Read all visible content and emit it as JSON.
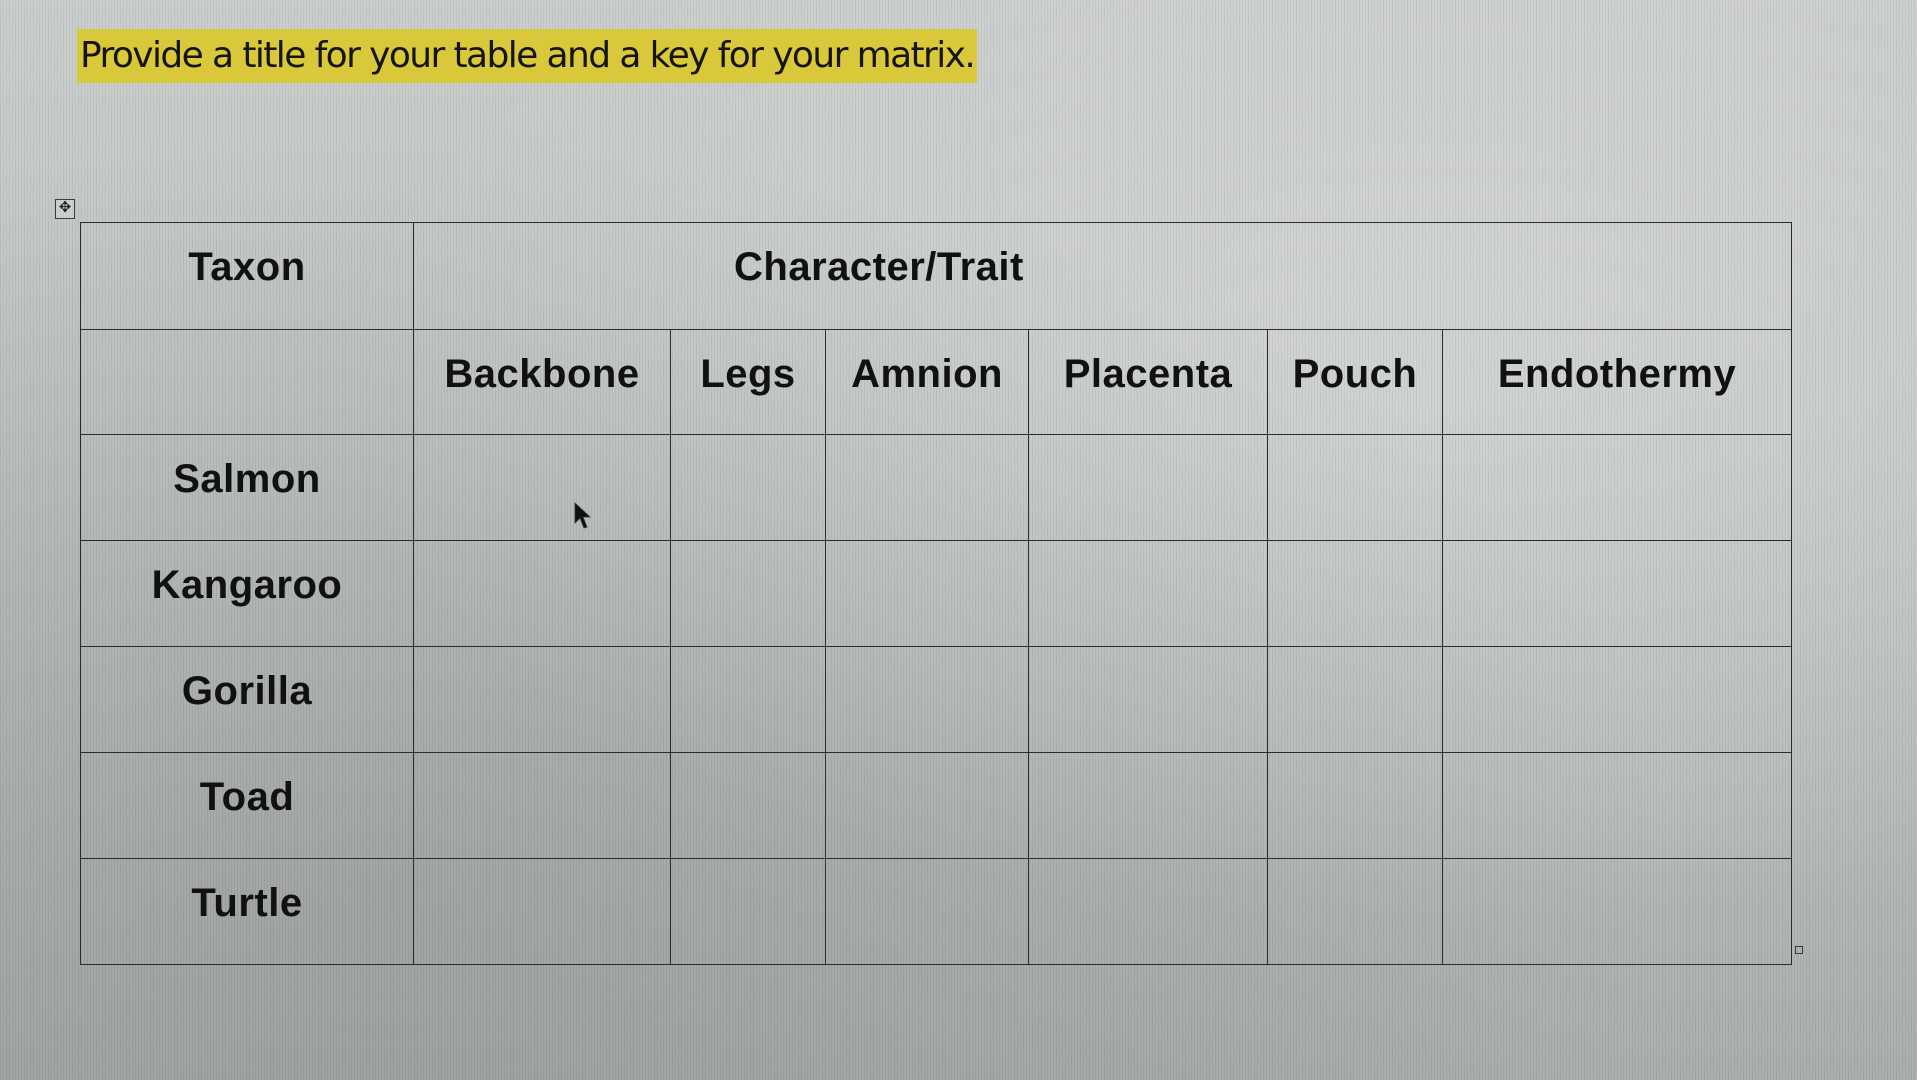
{
  "instruction": "Provide a title for your table and a key for your matrix.",
  "colors": {
    "highlight": "#d8c83a",
    "table_border": "#2b2d2d",
    "text": "#111111"
  },
  "icons": {
    "table_move_handle": "move-arrows-icon",
    "table_resize_handle": "resize-handle-icon",
    "mouse_cursor": "arrow-cursor-icon"
  },
  "table": {
    "taxon_header": "Taxon",
    "trait_header": "Character/Trait",
    "traits": [
      "Backbone",
      "Legs",
      "Amnion",
      "Placenta",
      "Pouch",
      "Endothermy"
    ],
    "taxa": [
      {
        "name": "Salmon",
        "values": [
          "",
          "",
          "",
          "",
          "",
          ""
        ]
      },
      {
        "name": "Kangaroo",
        "values": [
          "",
          "",
          "",
          "",
          "",
          ""
        ]
      },
      {
        "name": "Gorilla",
        "values": [
          "",
          "",
          "",
          "",
          "",
          ""
        ]
      },
      {
        "name": "Toad",
        "values": [
          "",
          "",
          "",
          "",
          "",
          ""
        ]
      },
      {
        "name": "Turtle",
        "values": [
          "",
          "",
          "",
          "",
          "",
          ""
        ]
      }
    ]
  }
}
